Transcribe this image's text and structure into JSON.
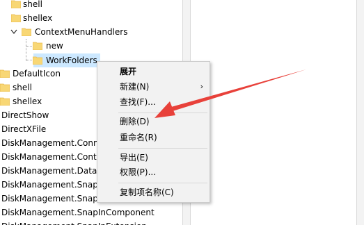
{
  "colors": {
    "folder_fill": "#f8d775",
    "folder_tab": "#e8b84a",
    "selection_bg": "#cce8ff",
    "menu_bg": "#f2f2f2",
    "arrow": "#e8413a"
  },
  "tree": {
    "items": [
      {
        "label": "shell",
        "icon": "folder-icon",
        "expander": ""
      },
      {
        "label": "shellex",
        "icon": "folder-icon",
        "expander": ""
      },
      {
        "label": "ContextMenuHandlers",
        "icon": "folder-icon",
        "expander": "expanded"
      },
      {
        "label": "new",
        "icon": "folder-icon",
        "expander": ""
      },
      {
        "label": "WorkFolders",
        "icon": "folder-icon",
        "expander": "",
        "selected": true
      },
      {
        "label": "DefaultIcon",
        "icon": "folder-icon",
        "expander": ""
      },
      {
        "label": "shell",
        "icon": "folder-icon",
        "expander": ""
      },
      {
        "label": "shellex",
        "icon": "folder-icon",
        "expander": ""
      },
      {
        "label": "DirectShow",
        "icon": "",
        "expander": ""
      },
      {
        "label": "DirectXFile",
        "icon": "",
        "expander": ""
      },
      {
        "label": "DiskManagement.Conn",
        "icon": "",
        "expander": ""
      },
      {
        "label": "DiskManagement.Contr",
        "icon": "",
        "expander": ""
      },
      {
        "label": "DiskManagement.DataO",
        "icon": "",
        "expander": ""
      },
      {
        "label": "DiskManagement.Snap",
        "icon": "",
        "expander": ""
      },
      {
        "label": "DiskManagement.Snap",
        "icon": "",
        "expander": ""
      },
      {
        "label": "DiskManagement.SnapInComponent",
        "icon": "",
        "expander": ""
      },
      {
        "label": "DiskManagement.SnapInExtension",
        "icon": "",
        "expander": ""
      }
    ]
  },
  "context_menu": {
    "items": [
      {
        "label": "展开",
        "bold": true,
        "submenu": false
      },
      {
        "label": "新建(N)",
        "bold": false,
        "submenu": true
      },
      {
        "label": "查找(F)...",
        "bold": false,
        "submenu": false
      },
      {
        "label": "删除(D)",
        "bold": false,
        "submenu": false
      },
      {
        "label": "重命名(R)",
        "bold": false,
        "submenu": false
      },
      {
        "label": "导出(E)",
        "bold": false,
        "submenu": false
      },
      {
        "label": "权限(P)...",
        "bold": false,
        "submenu": false
      },
      {
        "label": "复制项名称(C)",
        "bold": false,
        "submenu": false
      }
    ],
    "submenu_glyph": "›"
  }
}
